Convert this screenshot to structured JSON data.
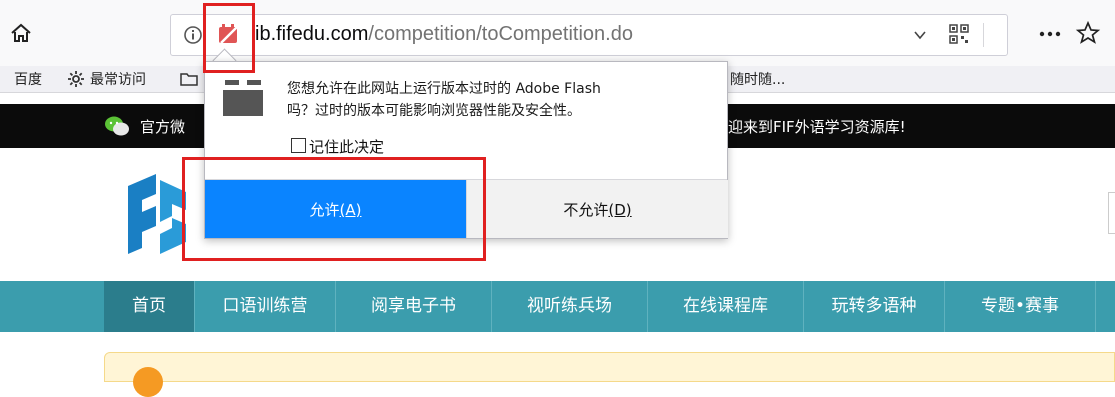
{
  "browser": {
    "url": {
      "prefix": "ib.",
      "host": "fifedu.com",
      "path": "/competition/toCompetition.do"
    },
    "bookmarks": [
      "百度",
      "最常访问",
      "随时随..."
    ]
  },
  "site": {
    "black_bar": {
      "left_text": "官方微",
      "right_text": "迎来到FIF外语学习资源库!"
    },
    "nav": [
      "首页",
      "口语训练营",
      "阅享电子书",
      "视听练兵场",
      "在线课程库",
      "玩转多语种",
      "专题•赛事"
    ]
  },
  "flash_prompt": {
    "message_line1": "您想允许在此网站上运行版本过时的 Adobe Flash",
    "message_line2": "吗？过时的版本可能影响浏览器性能及安全性。",
    "remember_label": "记住此决定",
    "allow_label": "允许",
    "allow_key": "(A)",
    "deny_label": "不允许",
    "deny_key": "(D)"
  },
  "colors": {
    "allow_button": "#0a84ff",
    "nav_bar": "#3b9dad",
    "highlight": "#e02020"
  }
}
